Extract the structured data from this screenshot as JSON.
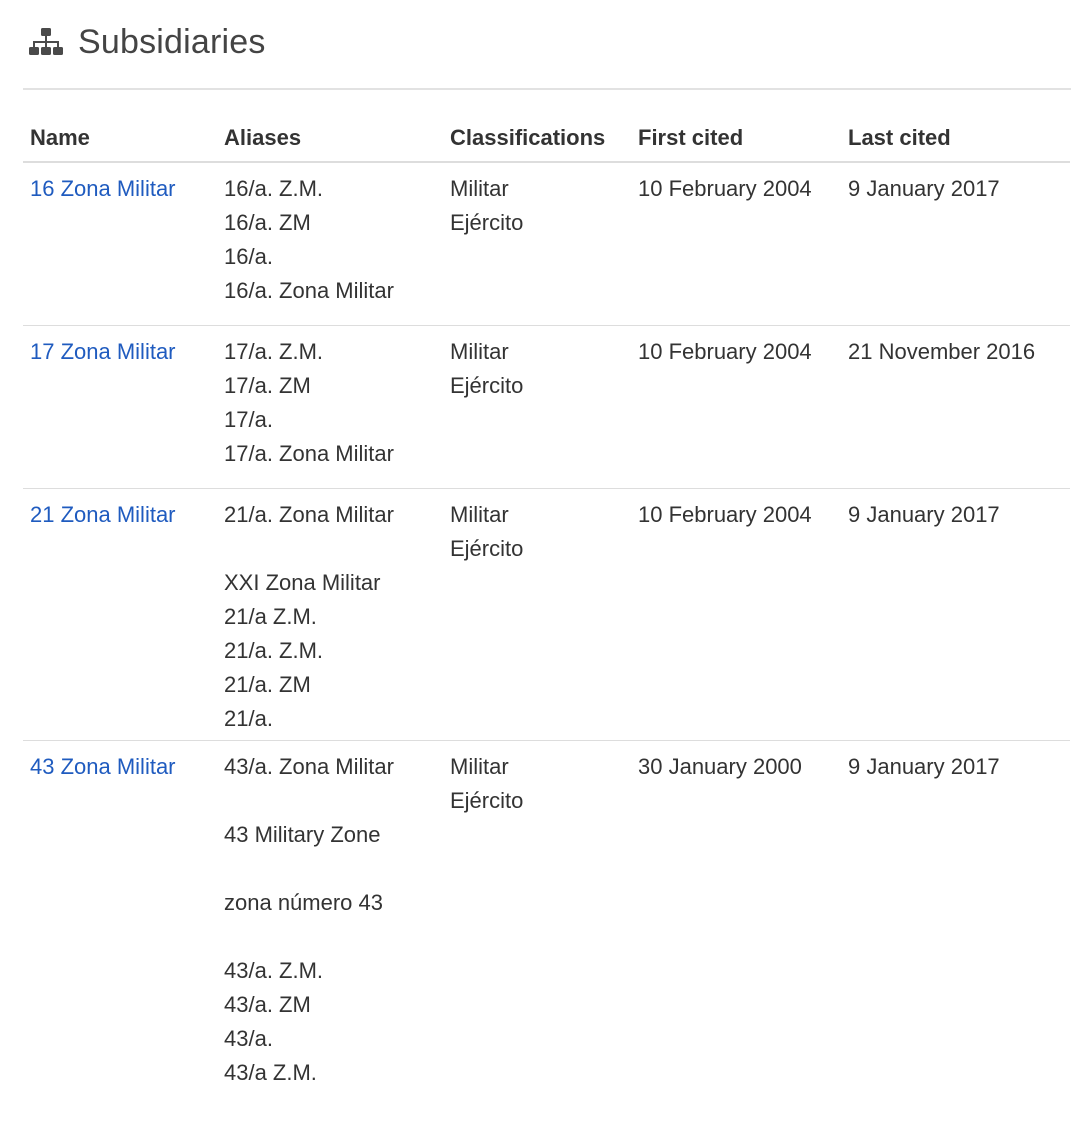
{
  "section": {
    "title": "Subsidiaries",
    "icon": "sitemap-icon"
  },
  "table": {
    "headers": {
      "name": "Name",
      "aliases": "Aliases",
      "classifications": "Classifications",
      "first_cited": "First cited",
      "last_cited": "Last cited"
    },
    "rows": [
      {
        "name": "16 Zona Militar",
        "aliases": [
          "16/a. Z.M.",
          "16/a. ZM",
          "16/a.",
          "16/a. Zona Militar"
        ],
        "classifications": [
          "Militar",
          "Ejército"
        ],
        "first_cited": "10 February 2004",
        "last_cited": "9 January 2017"
      },
      {
        "name": "17 Zona Militar",
        "aliases": [
          "17/a. Z.M.",
          "17/a. ZM",
          "17/a.",
          "17/a. Zona Militar"
        ],
        "classifications": [
          "Militar",
          "Ejército"
        ],
        "first_cited": "10 February 2004",
        "last_cited": "21 November 2016"
      },
      {
        "name": "21 Zona Militar",
        "aliases": [
          "21/a. Zona Militar",
          "",
          "XXI Zona Militar",
          "21/a Z.M.",
          "21/a. Z.M.",
          "21/a. ZM",
          "21/a."
        ],
        "classifications": [
          "Militar",
          "Ejército"
        ],
        "first_cited": "10 February 2004",
        "last_cited": "9 January 2017"
      },
      {
        "name": "43 Zona Militar",
        "aliases": [
          "43/a. Zona Militar",
          "",
          "43 Military Zone",
          "",
          "zona número 43",
          "",
          "43/a. Z.M.",
          "43/a. ZM",
          "43/a.",
          "43/a Z.M."
        ],
        "classifications": [
          "Militar",
          "Ejército"
        ],
        "first_cited": "30 January 2000",
        "last_cited": "9 January 2017"
      }
    ]
  },
  "colors": {
    "link": "#1f5bbf",
    "text": "#333333",
    "rule": "#dddddd"
  }
}
